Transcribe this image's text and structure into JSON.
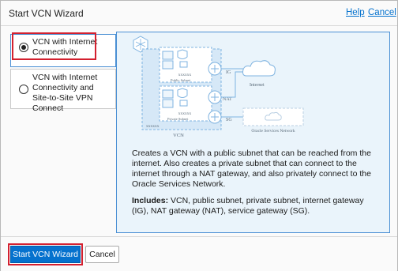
{
  "dialog": {
    "title": "Start VCN Wizard",
    "help_link": "Help",
    "cancel_link": "Cancel"
  },
  "options": [
    {
      "label": "VCN with Internet Connectivity",
      "selected": true
    },
    {
      "label": "VCN with Internet Connectivity and Site-to-Site VPN Connect",
      "selected": false
    }
  ],
  "diagram": {
    "public_subnet_label": "Public Subnet",
    "private_subnet_label": "Private Subnet",
    "cidr_placeholder": "xxxxxx",
    "vcn_cidr_placeholder": "xxxxxx",
    "vcn_label": "VCN",
    "ig_label": "IG",
    "nat_label": "NAT",
    "sg_label": "SG",
    "internet_label": "Internet",
    "oracle_network_label": "Oracle Services Network"
  },
  "description": {
    "paragraph": "Creates a VCN with a public subnet that can be reached from the internet. Also creates a private subnet that can connect to the internet through a NAT gateway, and also privately connect to the Oracle Services Network.",
    "includes_label": "Includes:",
    "includes_text": " VCN, public subnet, private subnet, internet gateway (IG), NAT gateway (NAT), service gateway (SG)."
  },
  "footer": {
    "start_button": "Start VCN Wizard",
    "cancel_button": "Cancel"
  },
  "colors": {
    "accent": "#0572ce",
    "highlight": "#d3202f",
    "panel_bg": "#eaf4fb",
    "diagram_line": "#7fb3e0"
  }
}
